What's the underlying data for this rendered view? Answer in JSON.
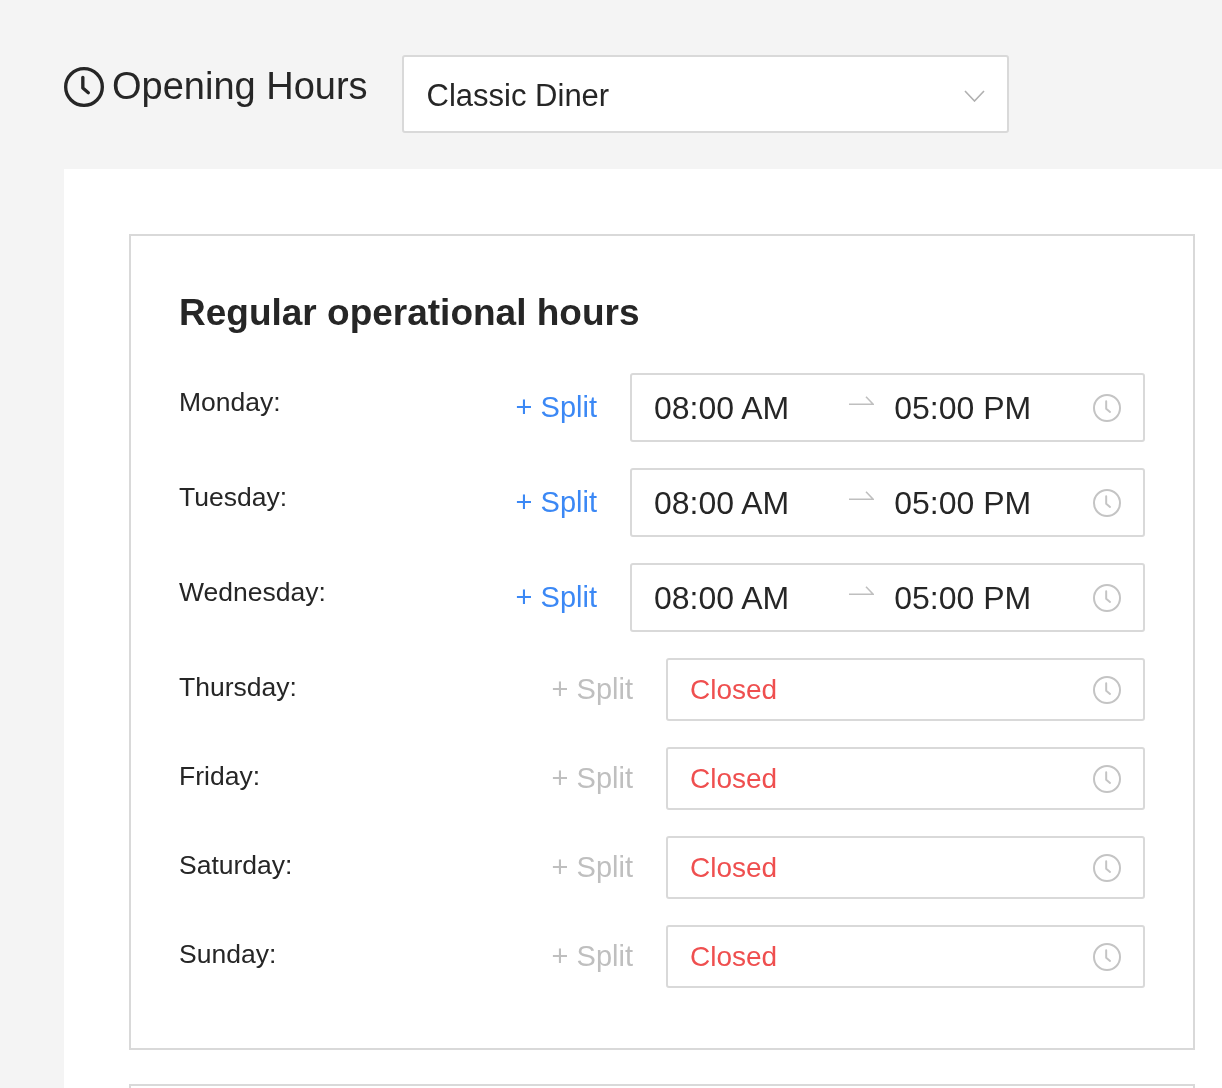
{
  "header": {
    "title": "Opening Hours",
    "restaurant_select": {
      "value": "Classic Diner"
    }
  },
  "card": {
    "title": "Regular operational hours",
    "days": [
      {
        "label": "Monday:",
        "split": {
          "label": "+ Split",
          "disabled": false
        },
        "hours": {
          "kind": "range",
          "start": "08:00 AM",
          "end": "05:00 PM"
        }
      },
      {
        "label": "Tuesday:",
        "split": {
          "label": "+ Split",
          "disabled": false
        },
        "hours": {
          "kind": "range",
          "start": "08:00 AM",
          "end": "05:00 PM"
        }
      },
      {
        "label": "Wednesday:",
        "split": {
          "label": "+ Split",
          "disabled": false
        },
        "hours": {
          "kind": "range",
          "start": "08:00 AM",
          "end": "05:00 PM"
        }
      },
      {
        "label": "Thursday:",
        "split": {
          "label": "+ Split",
          "disabled": true
        },
        "hours": {
          "kind": "closed",
          "text": "Closed"
        }
      },
      {
        "label": "Friday:",
        "split": {
          "label": "+ Split",
          "disabled": true
        },
        "hours": {
          "kind": "closed",
          "text": "Closed"
        }
      },
      {
        "label": "Saturday:",
        "split": {
          "label": "+ Split",
          "disabled": true
        },
        "hours": {
          "kind": "closed",
          "text": "Closed"
        }
      },
      {
        "label": "Sunday:",
        "split": {
          "label": "+ Split",
          "disabled": true
        },
        "hours": {
          "kind": "closed",
          "text": "Closed"
        }
      }
    ]
  }
}
